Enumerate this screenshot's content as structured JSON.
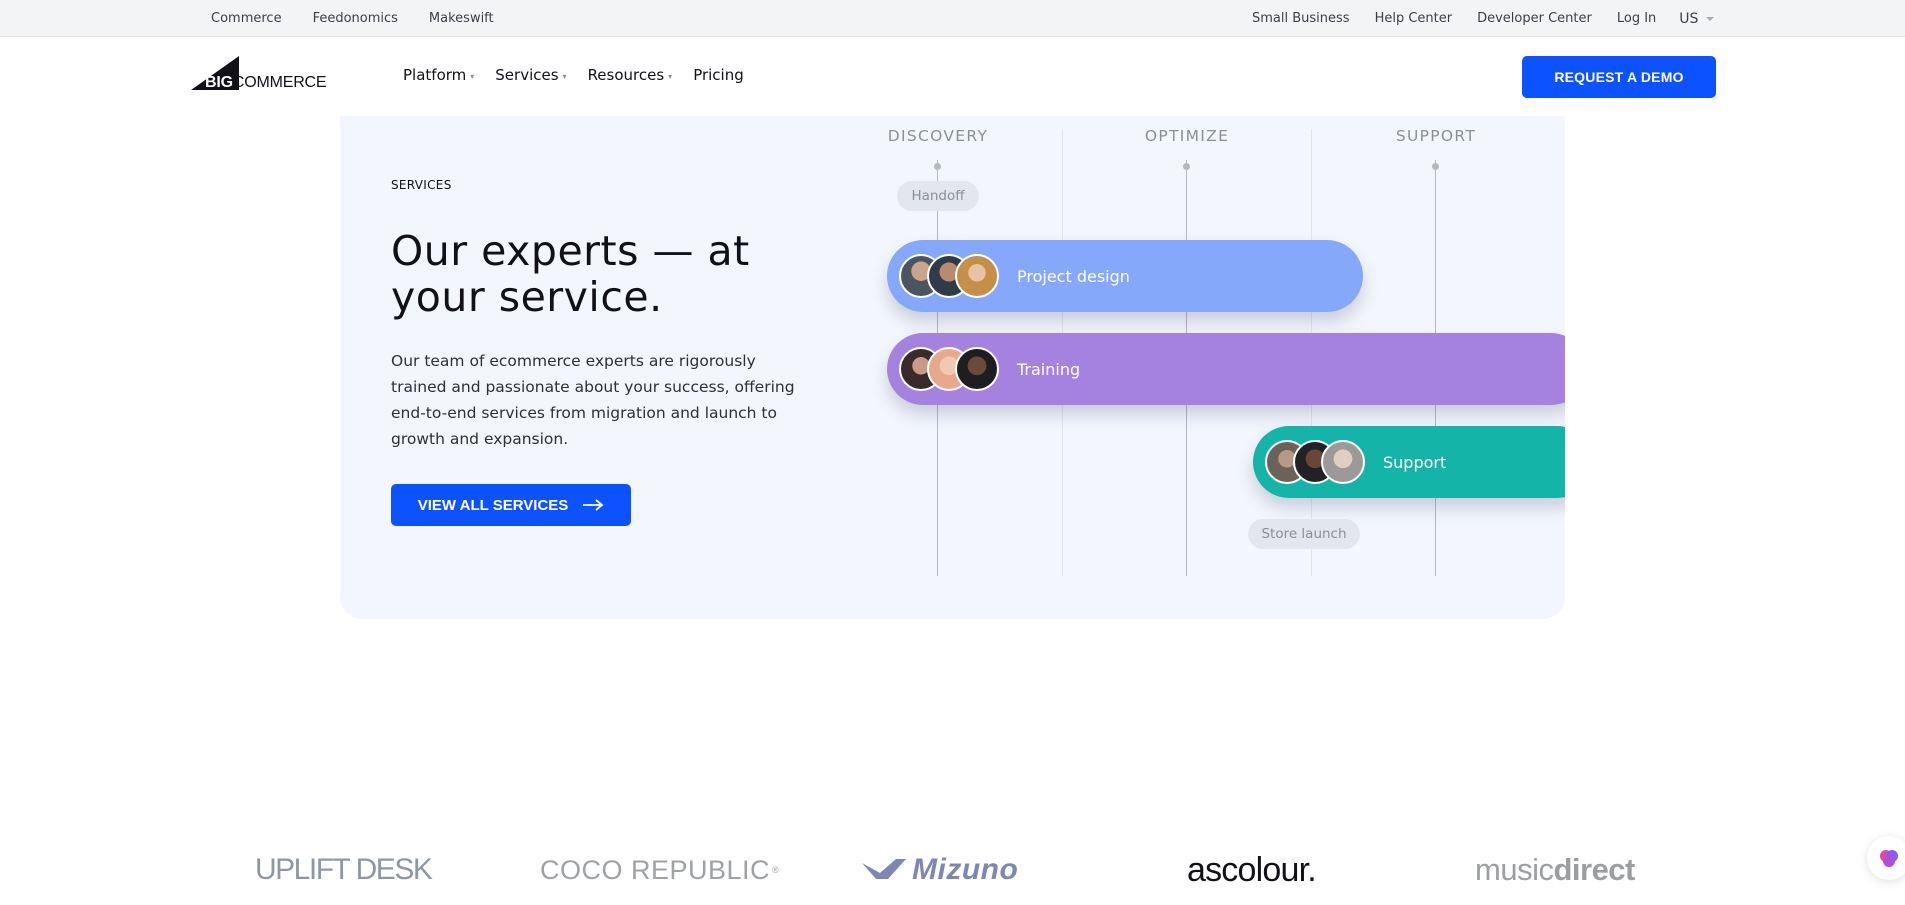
{
  "utility_bar": {
    "left_links": [
      "Commerce",
      "Feedonomics",
      "Makeswift"
    ],
    "right_links": [
      "Small Business",
      "Help Center",
      "Developer Center",
      "Log In"
    ],
    "locale": "US"
  },
  "nav": {
    "logo_big": "BIG",
    "logo_rest": "COMMERCE",
    "items": [
      {
        "label": "Platform",
        "has_dropdown": true
      },
      {
        "label": "Services",
        "has_dropdown": true
      },
      {
        "label": "Resources",
        "has_dropdown": true
      },
      {
        "label": "Pricing",
        "has_dropdown": false
      }
    ],
    "cta_label": "REQUEST A DEMO",
    "accent_color": "#0d52ff"
  },
  "services": {
    "eyebrow": "SERVICES",
    "headline": "Our experts — at your service.",
    "body": "Our team of ecommerce experts are rigorously trained and passionate about your success, offering end-to-end services from migration and launch to growth and expansion.",
    "cta_label": "VIEW ALL SERVICES",
    "cta_icon": "arrow-right-icon"
  },
  "timeline": {
    "columns": [
      "DISCOVERY",
      "OPTIMIZE",
      "SUPPORT"
    ],
    "milestones": [
      "Handoff",
      "Store launch"
    ],
    "bars": [
      {
        "label": "Project design",
        "color": "#86a8fb"
      },
      {
        "label": "Training",
        "color": "#a581e0"
      },
      {
        "label": "Support",
        "color": "#14b5a8"
      }
    ]
  },
  "logos": {
    "uplift": "UPLIFT DESK",
    "coco": "COCO REPUBLIC",
    "coco_mark": "®",
    "mizuno": "Mizuno",
    "ascolour": "ascolour.",
    "music_light": "music",
    "music_bold": "direct"
  }
}
